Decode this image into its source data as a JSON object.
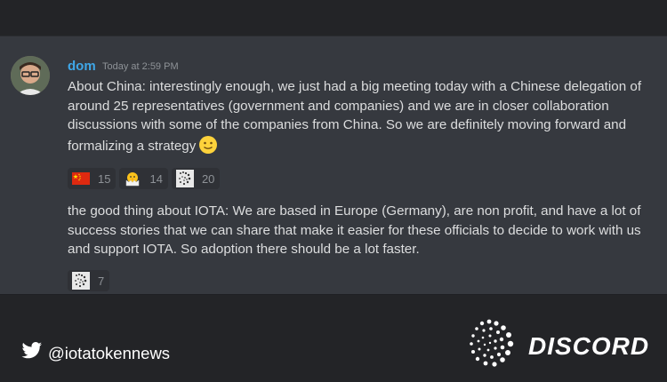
{
  "message": {
    "author": "dom",
    "timestamp": "Today at 2:59 PM",
    "text_1": "About China: interestingly enough, we just had a big meeting today with a Chinese delegation of around 25 representatives (government and companies) and we are in closer collaboration discussions with some of the companies from China. So we are definitely moving forward and formalizing a strategy",
    "inline_emoji": "slightly-smiling-face",
    "reactions_1": [
      {
        "emoji": "china-flag-icon",
        "count": "15"
      },
      {
        "emoji": "hatching-chick-icon",
        "count": "14"
      },
      {
        "emoji": "iota-logo-icon",
        "count": "20"
      }
    ],
    "text_2": "the good thing about IOTA: We are based in Europe (Germany), are non profit, and have a lot of success stories that we can share that make it easier for these officials to decide to work with us and support IOTA. So adoption there should be a lot faster.",
    "reactions_2": [
      {
        "emoji": "iota-logo-icon",
        "count": "7"
      }
    ]
  },
  "footer": {
    "twitter_handle": "@iotatokennews",
    "brand": "DISCORD"
  },
  "colors": {
    "background": "#232427",
    "panel": "#36393f",
    "username": "#3fa7e8",
    "text": "#dcddde"
  }
}
